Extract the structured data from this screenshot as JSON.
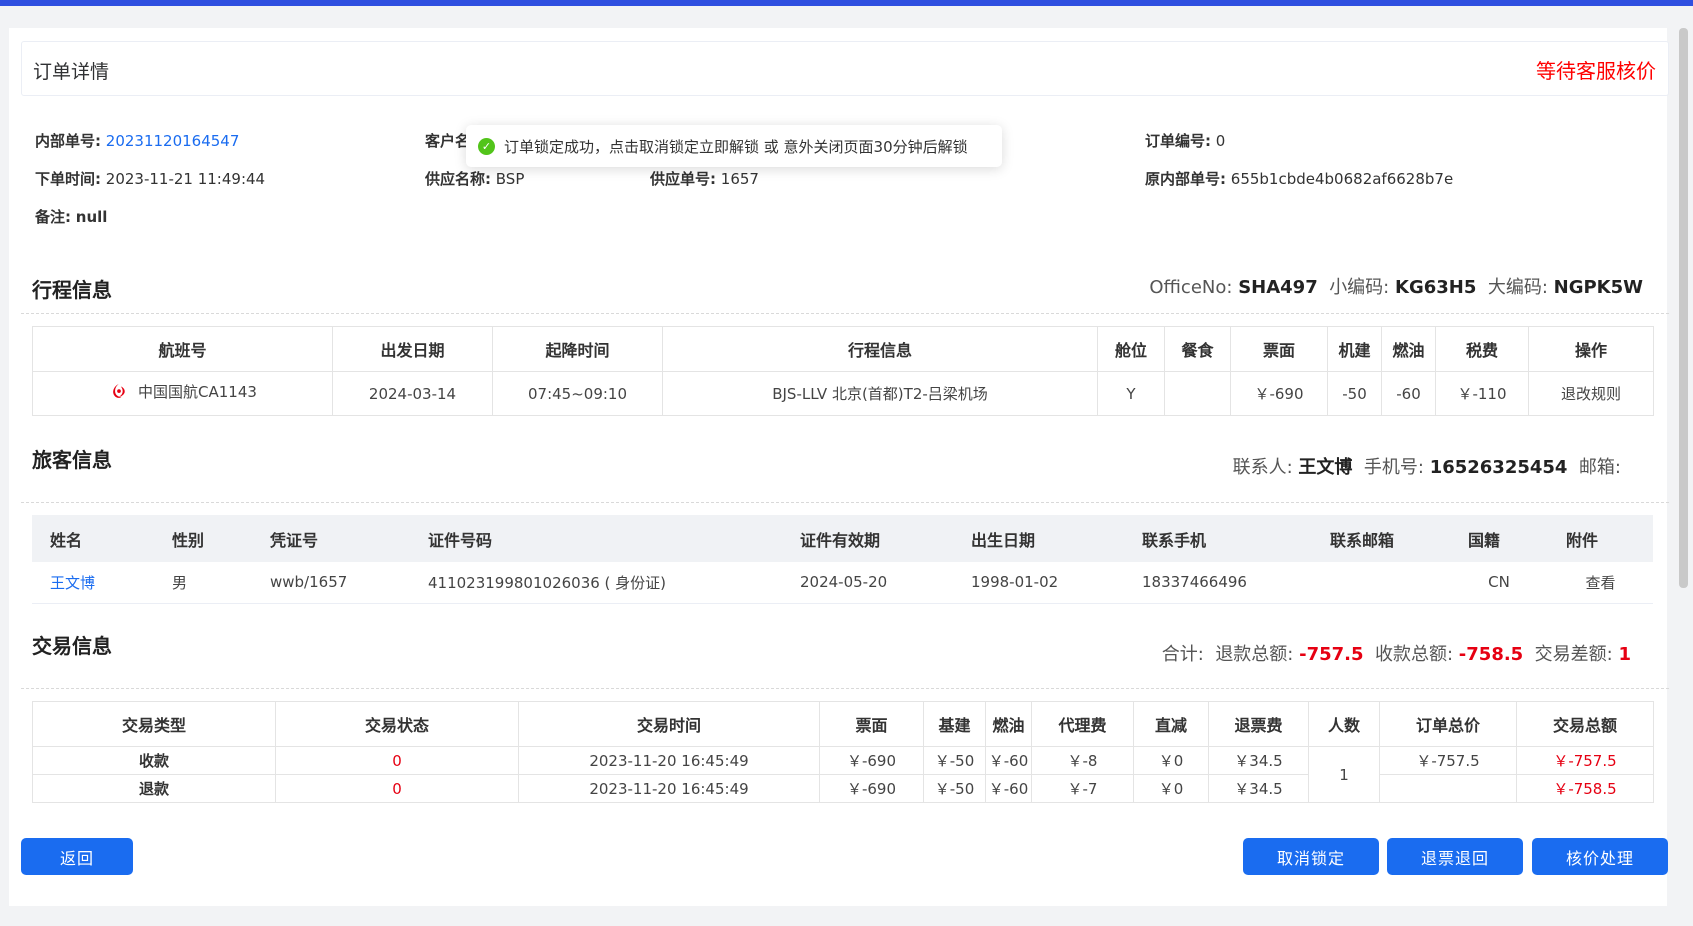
{
  "header": {
    "title": "订单详情",
    "status": "等待客服核价"
  },
  "order": {
    "internal_no_label": "内部单号:",
    "internal_no": "20231120164547",
    "customer_label": "客户名",
    "order_no_label": "订单编号:",
    "order_no": "0",
    "order_time_label": "下单时间:",
    "order_time": "2023-11-21 11:49:44",
    "supplier_label": "供应名称:",
    "supplier": "BSP",
    "supply_no_label": "供应单号:",
    "supply_no": "1657",
    "orig_no_label": "原内部单号:",
    "orig_no": "655b1cbde4b0682af6628b7e",
    "remark_label": "备注:",
    "remark": "null"
  },
  "toast": {
    "message": "订单锁定成功，点击取消锁定立即解锁 或 意外关闭页面30分钟后解锁"
  },
  "itinerary": {
    "title": "行程信息",
    "office_label": "OfficeNo:",
    "office": "SHA497",
    "small_code_label": "小编码:",
    "small_code": "KG63H5",
    "big_code_label": "大编码:",
    "big_code": "NGPK5W",
    "headers": [
      "航班号",
      "出发日期",
      "起降时间",
      "行程信息",
      "舱位",
      "餐食",
      "票面",
      "机建",
      "燃油",
      "税费",
      "操作"
    ],
    "row": {
      "flight": "中国国航CA1143",
      "date": "2024-03-14",
      "time": "07:45~09:10",
      "route": "BJS-LLV    北京(首都)T2-吕梁机场",
      "cabin": "Y",
      "meal": "",
      "fare": "￥-690",
      "airport_fee": "-50",
      "fuel": "-60",
      "tax": "￥-110",
      "action": "退改规则"
    }
  },
  "passenger": {
    "title": "旅客信息",
    "contact_label": "联系人:",
    "contact": "王文博",
    "phone_label": "手机号:",
    "phone": "16526325454",
    "email_label": "邮箱:",
    "headers": [
      "姓名",
      "性别",
      "凭证号",
      "证件号码",
      "证件有效期",
      "出生日期",
      "联系手机",
      "联系邮箱",
      "国籍",
      "附件"
    ],
    "row": {
      "name": "王文博",
      "gender": "男",
      "voucher": "wwb/1657",
      "id_no": "411023199801026036 ( 身份证)",
      "id_valid": "2024-05-20",
      "birth": "1998-01-02",
      "mobile": "18337466496",
      "email": "",
      "nation": "CN",
      "attach": "查看"
    }
  },
  "trade": {
    "title": "交易信息",
    "sum_label": "合计:",
    "refund_total_label": "退款总额:",
    "refund_total": "-757.5",
    "receive_total_label": "收款总额:",
    "receive_total": "-758.5",
    "diff_label": "交易差额:",
    "diff": "1",
    "headers": [
      "交易类型",
      "交易状态",
      "交易时间",
      "票面",
      "基建",
      "燃油",
      "代理费",
      "直减",
      "退票费",
      "人数",
      "订单总价",
      "交易总额"
    ],
    "rows": [
      {
        "type": "收款",
        "status": "0",
        "time": "2023-11-20 16:45:49",
        "fare": "￥-690",
        "base": "￥-50",
        "fuel": "￥-60",
        "agent": "￥-8",
        "direct": "￥0",
        "refund_fee": "￥34.5",
        "total_price": "￥-757.5",
        "amount": "￥-757.5"
      },
      {
        "type": "退款",
        "status": "0",
        "time": "2023-11-20 16:45:49",
        "fare": "￥-690",
        "base": "￥-50",
        "fuel": "￥-60",
        "agent": "￥-7",
        "direct": "￥0",
        "refund_fee": "￥34.5",
        "total_price": "",
        "amount": "￥-758.5"
      }
    ],
    "people": "1"
  },
  "buttons": {
    "back": "返回",
    "cancel_lock": "取消锁定",
    "refund_back": "退票退回",
    "check_price": "核价处理"
  },
  "colors": {
    "primary": "#1a6cf0",
    "danger": "#e60012",
    "topbar": "#2f4fe0"
  }
}
